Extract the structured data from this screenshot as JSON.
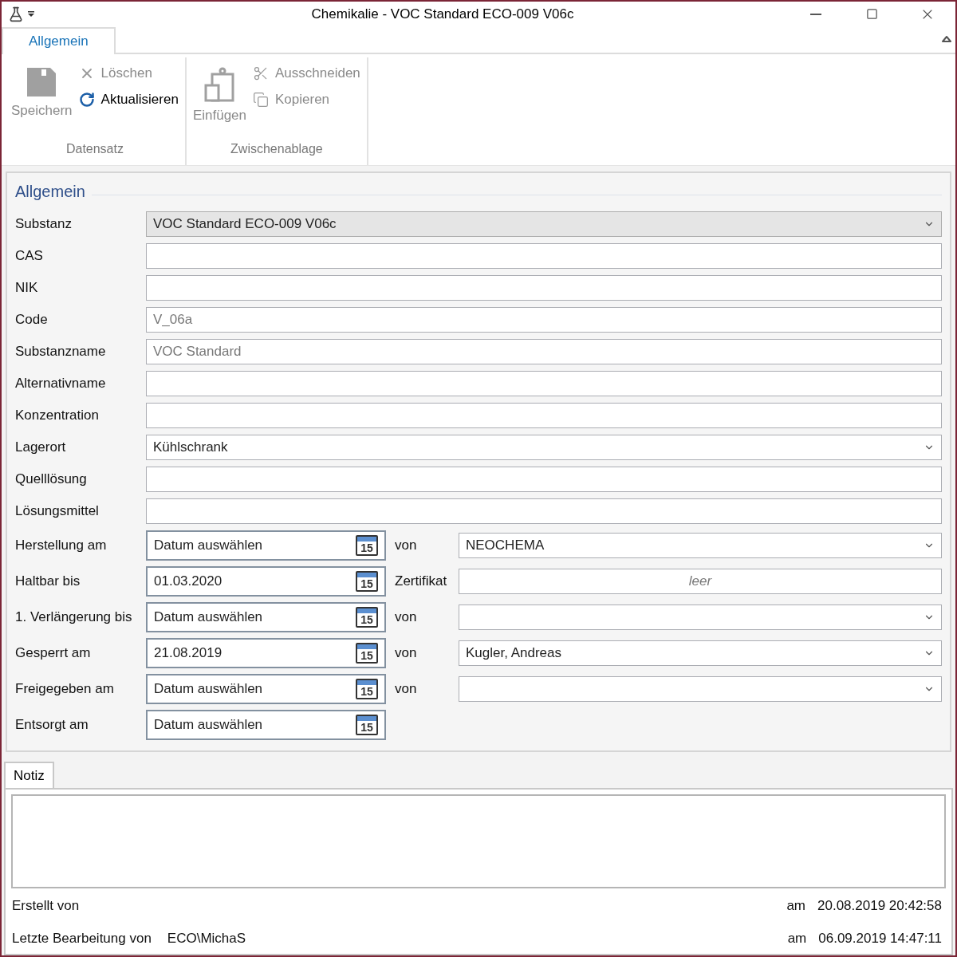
{
  "window": {
    "title": "Chemikalie - VOC Standard ECO-009 V06c"
  },
  "ribbon_tabs": [
    {
      "label": "Allgemein",
      "selected": true
    }
  ],
  "ribbon_groups": [
    {
      "label": "Datensatz",
      "large": {
        "kind": "save",
        "label": "Speichern",
        "disabled": true
      },
      "small": [
        {
          "kind": "delete",
          "label": "Löschen",
          "disabled": true
        },
        {
          "kind": "refresh",
          "label": "Aktualisieren",
          "disabled": false
        }
      ]
    },
    {
      "label": "Zwischenablage",
      "large": {
        "kind": "paste",
        "label": "Einfügen",
        "disabled": true
      },
      "small": [
        {
          "kind": "cut",
          "label": "Ausschneiden",
          "disabled": true
        },
        {
          "kind": "copy",
          "label": "Kopieren",
          "disabled": true
        }
      ]
    }
  ],
  "form": {
    "title": "Allgemein",
    "fields": [
      {
        "label": "Substanz",
        "kind": "combo",
        "value": "VOC Standard ECO-009 V06c",
        "disabled": true
      },
      {
        "label": "CAS",
        "kind": "text"
      },
      {
        "label": "NIK",
        "kind": "text"
      },
      {
        "label": "Code",
        "kind": "text",
        "value": "V_06a",
        "disabled": true
      },
      {
        "label": "Substanzname",
        "kind": "text",
        "value": "VOC Standard",
        "disabled": true
      },
      {
        "label": "Alternativname",
        "kind": "text"
      },
      {
        "label": "Konzentration",
        "kind": "text"
      },
      {
        "label": "Lagerort",
        "kind": "combo",
        "value": "Kühlschrank",
        "disabled": false
      },
      {
        "label": "Quelllösung",
        "kind": "text"
      },
      {
        "label": "Lösungsmittel",
        "kind": "text"
      }
    ],
    "date_rows": [
      {
        "label": "Herstellung am",
        "date": {
          "placeholder": "Datum auswählen",
          "icon_text": "15"
        },
        "right": {
          "label": "von",
          "kind": "combo",
          "value": "NEOCHEMA"
        }
      },
      {
        "label": "Haltbar bis",
        "date": {
          "value": "01.03.2020",
          "icon_text": "15"
        },
        "right": {
          "label": "Zertifikat",
          "kind": "text",
          "placeholder": "leer"
        }
      },
      {
        "label": "1. Verlängerung bis",
        "date": {
          "placeholder": "Datum auswählen",
          "icon_text": "15"
        },
        "right": {
          "label": "von",
          "kind": "combo"
        }
      },
      {
        "label": "Gesperrt am",
        "date": {
          "value": "21.08.2019",
          "icon_text": "15"
        },
        "right": {
          "label": "von",
          "kind": "combo",
          "value": "Kugler, Andreas"
        }
      },
      {
        "label": "Freigegeben am",
        "date": {
          "placeholder": "Datum auswählen",
          "icon_text": "15"
        },
        "right": {
          "label": "von",
          "kind": "combo"
        }
      },
      {
        "label": "Entsorgt am",
        "date": {
          "placeholder": "Datum auswählen",
          "icon_text": "15"
        }
      }
    ]
  },
  "note_tabs": [
    {
      "label": "Notiz",
      "selected": true
    }
  ],
  "footer": [
    {
      "label": "Erstellt von",
      "at_label": "am",
      "timestamp": "20.08.2019 20:42:58"
    },
    {
      "label": "Letzte Bearbeitung von",
      "user": "ECO\\MichaS",
      "at_label": "am",
      "timestamp": "06.09.2019 14:47:11"
    }
  ]
}
